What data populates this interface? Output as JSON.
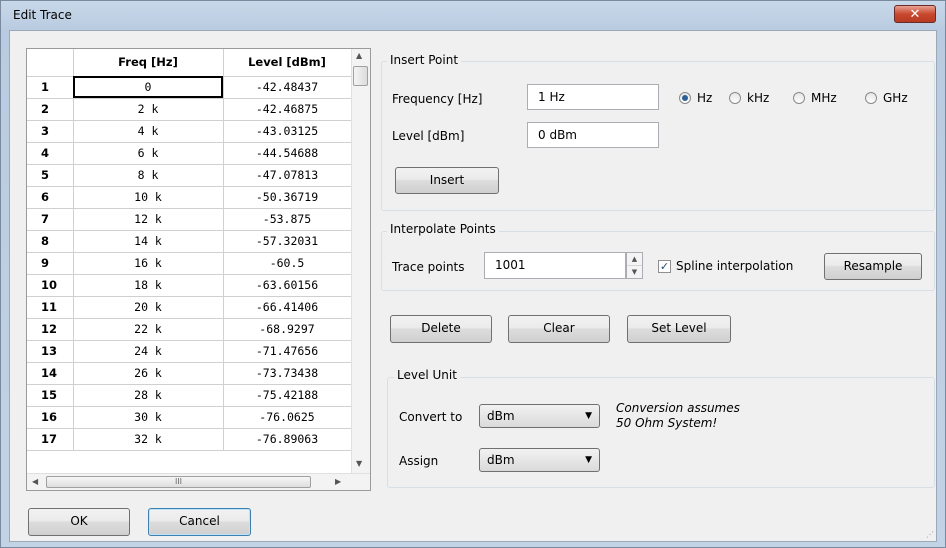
{
  "window": {
    "title": "Edit Trace",
    "close_glyph": "✕"
  },
  "table": {
    "columns": [
      "Freq [Hz]",
      "Level [dBm]"
    ],
    "rows": [
      {
        "n": "1",
        "freq": "0",
        "level": "-42.48437"
      },
      {
        "n": "2",
        "freq": "2 k",
        "level": "-42.46875"
      },
      {
        "n": "3",
        "freq": "4 k",
        "level": "-43.03125"
      },
      {
        "n": "4",
        "freq": "6 k",
        "level": "-44.54688"
      },
      {
        "n": "5",
        "freq": "8 k",
        "level": "-47.07813"
      },
      {
        "n": "6",
        "freq": "10 k",
        "level": "-50.36719"
      },
      {
        "n": "7",
        "freq": "12 k",
        "level": "-53.875"
      },
      {
        "n": "8",
        "freq": "14 k",
        "level": "-57.32031"
      },
      {
        "n": "9",
        "freq": "16 k",
        "level": "-60.5"
      },
      {
        "n": "10",
        "freq": "18 k",
        "level": "-63.60156"
      },
      {
        "n": "11",
        "freq": "20 k",
        "level": "-66.41406"
      },
      {
        "n": "12",
        "freq": "22 k",
        "level": "-68.9297"
      },
      {
        "n": "13",
        "freq": "24 k",
        "level": "-71.47656"
      },
      {
        "n": "14",
        "freq": "26 k",
        "level": "-73.73438"
      },
      {
        "n": "15",
        "freq": "28 k",
        "level": "-75.42188"
      },
      {
        "n": "16",
        "freq": "30 k",
        "level": "-76.0625"
      },
      {
        "n": "17",
        "freq": "32 k",
        "level": "-76.89063"
      }
    ]
  },
  "insert_point": {
    "group_label": "Insert Point",
    "frequency_label": "Frequency [Hz]",
    "frequency_value": "1 Hz",
    "level_label": "Level [dBm]",
    "level_value": "0 dBm",
    "units": [
      "Hz",
      "kHz",
      "MHz",
      "GHz"
    ],
    "selected_unit": "Hz",
    "insert_button": "Insert"
  },
  "interpolate": {
    "group_label": "Interpolate Points",
    "trace_points_label": "Trace points",
    "trace_points_value": "1001",
    "spline_label": "Spline interpolation",
    "spline_checked": true,
    "resample_button": "Resample"
  },
  "actions": {
    "delete": "Delete",
    "clear": "Clear",
    "set_level": "Set Level"
  },
  "level_unit": {
    "group_label": "Level Unit",
    "convert_label": "Convert to",
    "convert_value": "dBm",
    "note_line1": "Conversion assumes",
    "note_line2": "50 Ohm System!",
    "assign_label": "Assign",
    "assign_value": "dBm"
  },
  "footer": {
    "ok": "OK",
    "cancel": "Cancel"
  },
  "scrollbar": {
    "grip": "III"
  }
}
